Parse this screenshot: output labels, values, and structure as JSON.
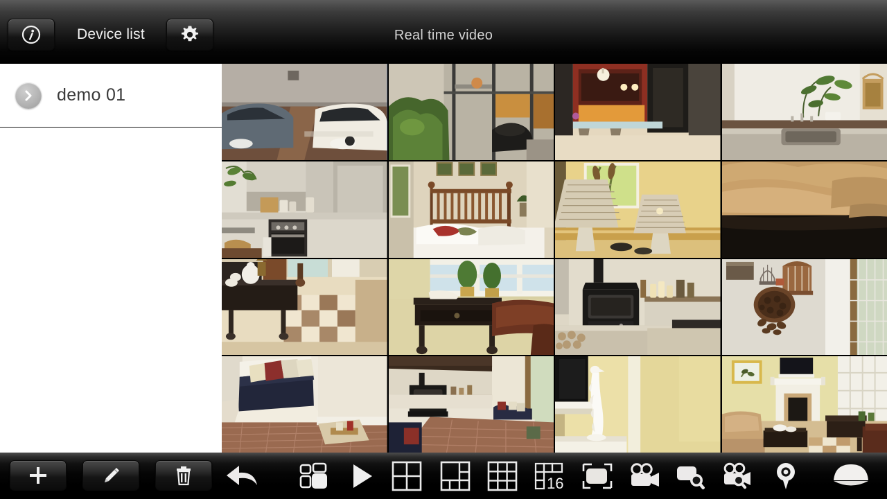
{
  "app": {
    "title": "Real time video"
  },
  "header": {
    "info_button": {
      "name": "info-icon",
      "label": "i"
    },
    "device_list_label": "Device list",
    "gear_button": {
      "name": "gear-icon"
    },
    "title": "Real time video"
  },
  "sidebar": {
    "devices": [
      {
        "name": "demo 01",
        "chevron": "chevron-right-icon"
      }
    ]
  },
  "video_grid": {
    "layout": "4x4",
    "cells": [
      {
        "index": 1,
        "scene": "garage-two-cars",
        "selected": true
      },
      {
        "index": 2,
        "scene": "patio-glass-doors",
        "selected": false
      },
      {
        "index": 3,
        "scene": "kitchen-bar-stools",
        "selected": false
      },
      {
        "index": 4,
        "scene": "bathroom-sink-plant",
        "selected": false
      },
      {
        "index": 5,
        "scene": "kitchen-stove",
        "selected": false
      },
      {
        "index": 6,
        "scene": "bedroom-wooden-bed",
        "selected": false
      },
      {
        "index": 7,
        "scene": "two-table-lamps",
        "selected": false
      },
      {
        "index": 8,
        "scene": "leather-sofa-closeup",
        "selected": false
      },
      {
        "index": 9,
        "scene": "living-room-checker-floor",
        "selected": false
      },
      {
        "index": 10,
        "scene": "window-table-topiary",
        "selected": false
      },
      {
        "index": 11,
        "scene": "wood-stove-fireplace",
        "selected": false
      },
      {
        "index": 12,
        "scene": "wall-decor-birdcage",
        "selected": false
      },
      {
        "index": 13,
        "scene": "window-bench-cushions",
        "selected": false
      },
      {
        "index": 14,
        "scene": "corner-nook-stove",
        "selected": false
      },
      {
        "index": 15,
        "scene": "mantel-white-statue",
        "selected": false
      },
      {
        "index": 16,
        "scene": "living-room-fireplace-tv",
        "selected": false
      }
    ]
  },
  "toolbar": {
    "buttons": [
      {
        "name": "add-device-button",
        "icon": "plus-icon"
      },
      {
        "name": "edit-device-button",
        "icon": "pencil-icon"
      },
      {
        "name": "delete-device-button",
        "icon": "trash-icon"
      }
    ],
    "icons": [
      {
        "name": "back-button",
        "icon": "back-arrow-icon"
      },
      {
        "name": "layout-button",
        "icon": "layout-panels-icon"
      },
      {
        "name": "play-button",
        "icon": "play-icon"
      },
      {
        "name": "split-4-button",
        "icon": "grid-2x2-icon",
        "label": ""
      },
      {
        "name": "split-6-button",
        "icon": "grid-6-icon",
        "label": ""
      },
      {
        "name": "split-9-button",
        "icon": "grid-3x3-icon",
        "label": ""
      },
      {
        "name": "split-16-button",
        "icon": "grid-16-icon",
        "label": "16"
      },
      {
        "name": "fullscreen-button",
        "icon": "fullscreen-icon"
      },
      {
        "name": "record-button",
        "icon": "video-camera-icon"
      },
      {
        "name": "snapshot-search-button",
        "icon": "snapshot-search-icon"
      },
      {
        "name": "video-search-button",
        "icon": "video-search-icon"
      },
      {
        "name": "location-button",
        "icon": "location-pin-icon"
      },
      {
        "name": "ptz-button",
        "icon": "ptz-dome-icon"
      }
    ],
    "split16_label": "16"
  },
  "colors": {
    "header_top": "#5a5a5a",
    "header_bottom": "#000000",
    "sidebar_bg": "#ffffff",
    "device_text": "#3a3a3a",
    "title_text": "#d2d2d2",
    "selection_border": "#4a6fa5",
    "icon_fill": "#f0f0f0"
  }
}
